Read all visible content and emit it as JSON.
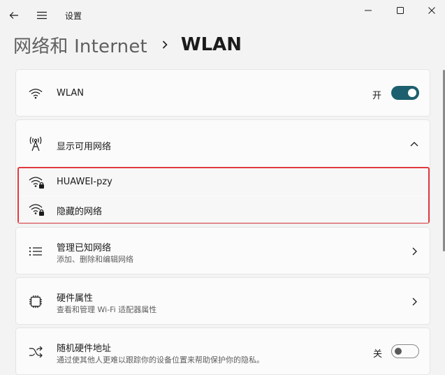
{
  "titlebar": {
    "app_title": "设置"
  },
  "breadcrumb": {
    "parent": "网络和 Internet",
    "current": "WLAN"
  },
  "wlan": {
    "label": "WLAN",
    "state": "开",
    "toggle_on": true
  },
  "available": {
    "label": "显示可用网络",
    "expanded": true
  },
  "networks": [
    {
      "name": "HUAWEI-pzy",
      "icon": "wifi-lock-icon"
    },
    {
      "name": "隐藏的网络",
      "icon": "wifi-lock-icon"
    }
  ],
  "manage": {
    "title": "管理已知网络",
    "subtitle": "添加、删除和编辑网络"
  },
  "hardware": {
    "title": "硬件属性",
    "subtitle": "查看和管理 Wi-Fi 适配器属性"
  },
  "random_mac": {
    "title": "随机硬件地址",
    "subtitle": "通过使其他人更难以跟踪你的设备位置来帮助保护你的隐私。",
    "state": "关",
    "toggle_on": false
  },
  "colors": {
    "accent": "#1d5f6f",
    "highlight_border": "#e0393e"
  }
}
